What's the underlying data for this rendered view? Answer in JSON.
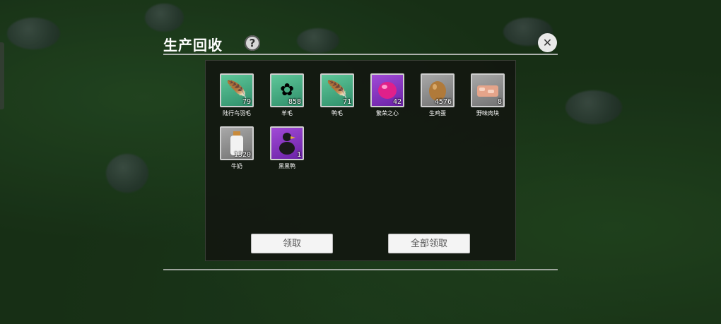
{
  "header": {
    "title": "生产回收",
    "help_icon": "?",
    "close_icon": "✕"
  },
  "items": [
    {
      "name": "陆行鸟羽毛",
      "qty": "79",
      "icon": "feather-icon",
      "bg": "green"
    },
    {
      "name": "羊毛",
      "qty": "858",
      "icon": "wool-icon",
      "bg": "green"
    },
    {
      "name": "鸭毛",
      "qty": "71",
      "icon": "feather-icon",
      "bg": "green"
    },
    {
      "name": "繁荣之心",
      "qty": "42",
      "icon": "gem-icon",
      "bg": "purple"
    },
    {
      "name": "生鸡蛋",
      "qty": "4576",
      "icon": "egg-icon",
      "bg": "grey"
    },
    {
      "name": "野味肉块",
      "qty": "8",
      "icon": "meat-icon",
      "bg": "grey"
    },
    {
      "name": "牛奶",
      "qty": "1320",
      "icon": "milk-icon",
      "bg": "grey"
    },
    {
      "name": "黑黑鸭",
      "qty": "1",
      "icon": "duck-icon",
      "bg": "purple"
    }
  ],
  "buttons": {
    "claim": "领取",
    "claim_all": "全部领取"
  }
}
